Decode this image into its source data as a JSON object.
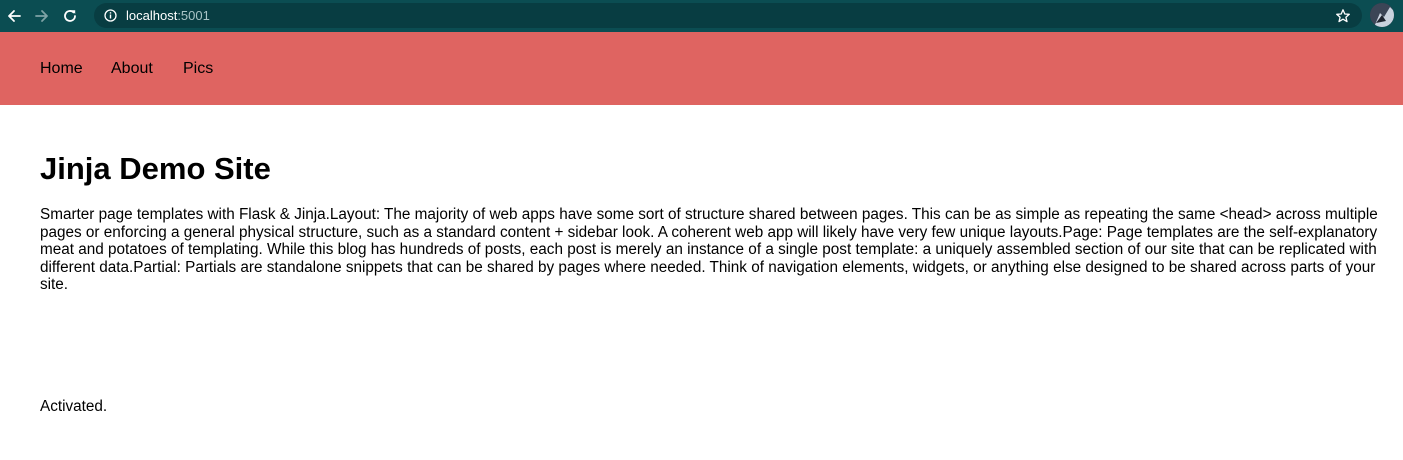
{
  "browser": {
    "url_host": "localhost",
    "url_port": ":5001",
    "icons": {
      "back": "back-arrow-icon",
      "forward": "forward-arrow-icon",
      "reload": "reload-icon",
      "info": "info-icon",
      "bookmark": "star-icon",
      "profile": "avatar"
    },
    "colors": {
      "toolbar": "#0b4d52",
      "omnibox": "#083d42"
    }
  },
  "nav": {
    "background": "#df6461",
    "items": [
      {
        "label": "Home"
      },
      {
        "label": "About"
      },
      {
        "label": "Pics"
      }
    ]
  },
  "main": {
    "title": "Jinja Demo Site",
    "intro": "Smarter page templates with Flask & Jinja.Layout: The majority of web apps have some sort of structure shared between pages. This can be as simple as repeating the same <head> across multiple pages or enforcing a general physical structure, such as a standard content + sidebar look. A coherent web app will likely have very few unique layouts.Page: Page templates are the self-explanatory meat and potatoes of templating. While this blog has hundreds of posts, each post is merely an instance of a single post template: a uniquely assembled section of our site that can be replicated with different data.Partial: Partials are standalone snippets that can be shared by pages where needed. Think of navigation elements, widgets, or anything else designed to be shared across parts of your site.",
    "status": "Activated."
  }
}
